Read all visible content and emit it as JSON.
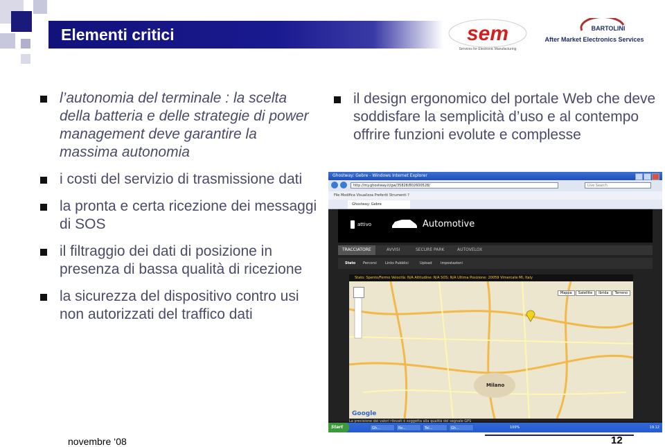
{
  "slide": {
    "title": "Elementi critici",
    "footer_date": "novembre ‘08",
    "page_number": "12"
  },
  "logos": {
    "sem": "sem",
    "sem_tagline": "Services for Electronic Manufacturing",
    "bartolini_name": "BARTOLINI",
    "bartolini_service": "After Market Electronics Services"
  },
  "left_bullets": [
    {
      "text": "l’autonomia del terminale : la scelta della batteria e delle strategie di power management deve garantire la massima autonomia"
    },
    {
      "text": "i costi del servizio di trasmissione dati"
    },
    {
      "text": "la pronta e certa ricezione dei messaggi di SOS"
    },
    {
      "text": "il filtraggio dei dati di posizione in presenza di bassa qualità di ricezione"
    },
    {
      "text": "la sicurezza del dispositivo contro usi non autorizzati del traffico dati"
    }
  ],
  "right_bullets": [
    {
      "text": "il design ergonomico del portale Web che deve soddisfare la semplicità d’uso e al contempo offrire funzioni evolute e complesse"
    }
  ],
  "screenshot": {
    "window_title": "Ghostway: Gebre - Windows Internet Explorer",
    "url": "http://my.ghostway.it/gw/35828/802600528/",
    "search_placeholder": "Live Search",
    "menu": "File   Modifica   Visualizza   Preferiti   Strumenti   ?",
    "tab_label": "Ghostway: Gebre",
    "app_attivo": "attivo",
    "app_title": "Automotive",
    "nav": [
      "TRACCIATORE",
      "AVVISI",
      "SECURE PARK",
      "AUTOVELOX"
    ],
    "subnav": [
      "Stato",
      "Percorsi",
      "Links Pubblici",
      "Upload",
      "Impostazioni"
    ],
    "status_line": "Stato: Spento/Fermo  Velocità: N/A  Altitudine: N/A  SOS: N/A  Ultima Posizione: 20059 Vimercate MI, Italy",
    "map_buttons": [
      "Mappa",
      "Satellite",
      "Ibrida",
      "Terreno"
    ],
    "map_city": "Milano",
    "google_label": "Google",
    "map_footer": "La precisione dei valori rilevati è soggetta alla qualità del segnale GPS",
    "start_label": "Start",
    "taskbar_items": [
      "Gh...",
      "Ro...",
      "Tel...",
      "Gh..."
    ],
    "zoom": "100%",
    "clock": "19.12"
  }
}
